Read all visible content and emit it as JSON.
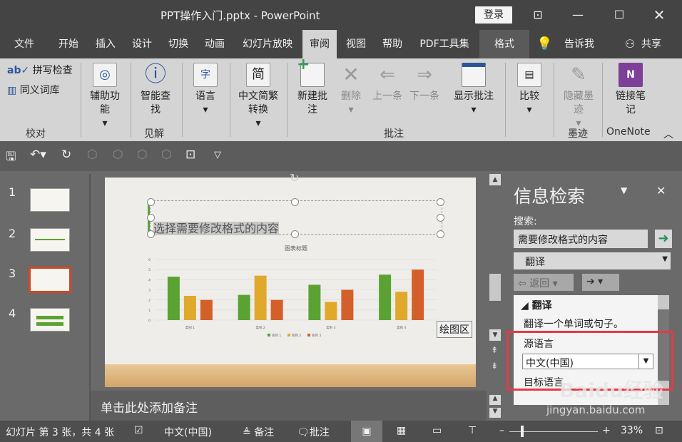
{
  "window": {
    "title": "PPT操作入门.pptx - PowerPoint",
    "login": "登录"
  },
  "tabs": [
    "文件",
    "开始",
    "插入",
    "设计",
    "切换",
    "动画",
    "幻灯片放映",
    "审阅",
    "视图",
    "帮助",
    "PDF工具集",
    "格式",
    "告诉我",
    "共享"
  ],
  "ribbon": {
    "spell": "拼写检查",
    "thesaurus": "同义词库",
    "group_proof": "校对",
    "access": "辅助功能",
    "group_access": "",
    "smart": "智能查找",
    "group_insight": "见解",
    "lang": "语言",
    "chinese": "中文简繁转换",
    "new_comment": "新建批注",
    "delete": "删除",
    "prev": "上一条",
    "next": "下一条",
    "show_comments": "显示批注",
    "group_comments": "批注",
    "compare": "比较",
    "hide_ink": "隐藏墨迹",
    "group_ink": "墨迹",
    "link_notes": "链接笔记",
    "group_onenote": "OneNote"
  },
  "slides": [
    "1",
    "2",
    "3",
    "4"
  ],
  "slide": {
    "textbox": "选择需要修改格式的内容",
    "placeholder_label": "绘图区"
  },
  "chart_data": {
    "type": "bar",
    "title": "图表标题",
    "categories": [
      "类别 1",
      "类别 2",
      "类别 3",
      "类别 4"
    ],
    "series": [
      {
        "name": "系列 1",
        "values": [
          4.3,
          2.5,
          3.5,
          4.5
        ],
        "color": "#5aa333"
      },
      {
        "name": "系列 2",
        "values": [
          2.4,
          4.4,
          1.8,
          2.8
        ],
        "color": "#e0a92c"
      },
      {
        "name": "系列 3",
        "values": [
          2.0,
          2.0,
          3.0,
          5.0
        ],
        "color": "#d3602a"
      }
    ],
    "yticks": [
      "0",
      "1",
      "2",
      "3",
      "4",
      "5",
      "6"
    ],
    "ylim": [
      0,
      6
    ],
    "legend": "bottom"
  },
  "notes": "单击此处添加备注",
  "panel": {
    "title": "信息检索",
    "search_label": "搜索:",
    "search_value": "需要修改格式的内容",
    "service": "翻译",
    "back": "返回",
    "section": "翻译",
    "desc": "翻译一个单词或句子。",
    "source_label": "源语言",
    "source_value": "中文(中国)",
    "target_label": "目标语言"
  },
  "status": {
    "slide": "幻灯片 第 3 张，共 4 张",
    "lang": "中文(中国)",
    "notes": "备注",
    "comments": "批注",
    "zoom": "33%"
  },
  "watermark": {
    "brand": "Baidu经验",
    "url": "jingyan.baidu.com"
  },
  "colors": {
    "accent": "#d24726",
    "highlight": "#e53946"
  }
}
